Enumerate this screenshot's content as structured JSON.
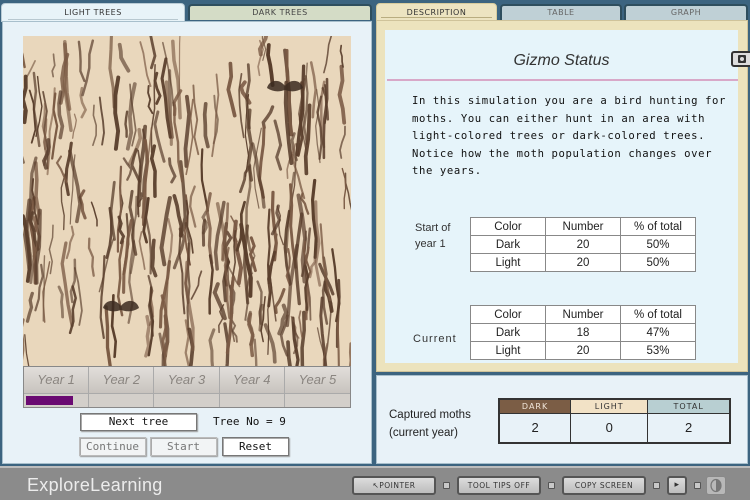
{
  "left_tabs": [
    {
      "label": "LIGHT TREES",
      "active": true
    },
    {
      "label": "DARK TREES",
      "active": false
    }
  ],
  "tree_view": {
    "tree_type": "light",
    "moths_visible": 2,
    "colors": {
      "bark_light": "#e9d7bc",
      "bark_dark": "#5a3f2d",
      "moth": "#3b2a20"
    }
  },
  "years": {
    "labels": [
      "Year 1",
      "Year 2",
      "Year 3",
      "Year 4",
      "Year 5"
    ],
    "current_year_index": 0,
    "current_year_progress": 0.8,
    "progress_color": "#6a0a72"
  },
  "controls": {
    "next_tree_label": "Next tree",
    "tree_no_text": "Tree No = 9",
    "continue_label": "Continue",
    "start_label": "Start",
    "reset_label": "Reset"
  },
  "right_tabs": [
    {
      "label": "DESCRIPTION",
      "active": true
    },
    {
      "label": "TABLE",
      "active": false
    },
    {
      "label": "GRAPH",
      "active": false
    }
  ],
  "status": {
    "title": "Gizmo Status",
    "camera_icon": "camera-icon",
    "description": "In this simulation you are a bird hunting for moths.  You can either hunt in an area with light-colored trees or dark-colored trees.  Notice how the moth population changes over the years."
  },
  "start_table": {
    "label_line1": "Start of",
    "label_line2": "year 1",
    "headers": [
      "Color",
      "Number",
      "% of total"
    ],
    "rows": [
      [
        "Dark",
        "20",
        "50%"
      ],
      [
        "Light",
        "20",
        "50%"
      ]
    ]
  },
  "current_table": {
    "label": "Current",
    "headers": [
      "Color",
      "Number",
      "% of total"
    ],
    "rows": [
      [
        "Dark",
        "18",
        "47%"
      ],
      [
        "Light",
        "20",
        "53%"
      ]
    ]
  },
  "captured": {
    "label_line1": "Captured moths",
    "label_line2": "(current year)",
    "headers": [
      "DARK",
      "LIGHT",
      "TOTAL"
    ],
    "values": [
      "2",
      "0",
      "2"
    ],
    "header_colors": {
      "dark": "#7b5d45",
      "light": "#f2e2c6",
      "total": "#b8cfd2"
    }
  },
  "bottom_bar": {
    "logo": "ExploreLearning",
    "pointer_label": "↖POINTER",
    "tooltips_label": "TOOL TIPS OFF",
    "copy_screen_label": "COPY SCREEN",
    "play_icon": "▸"
  }
}
